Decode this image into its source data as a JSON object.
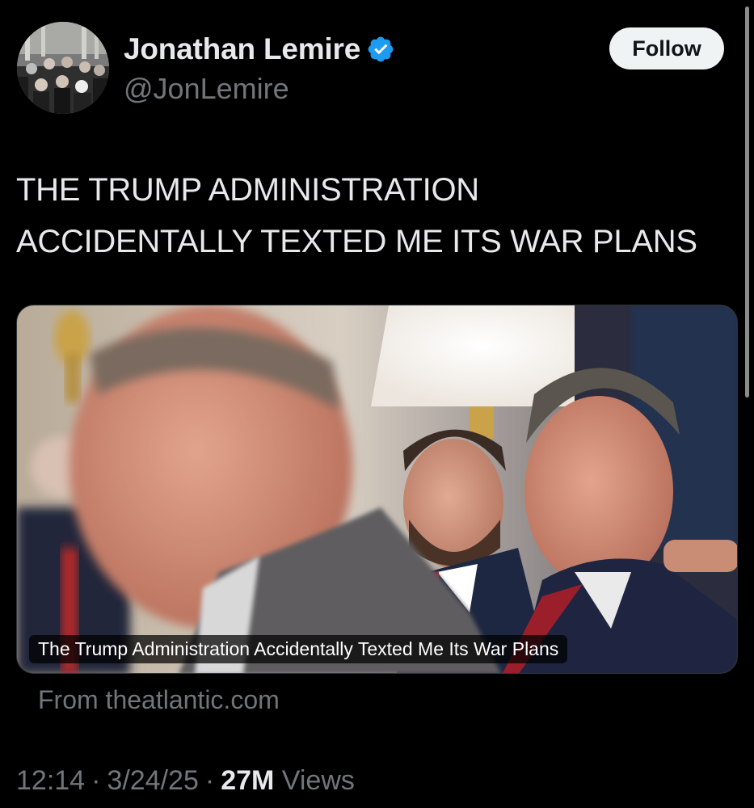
{
  "author": {
    "display_name": "Jonathan Lemire",
    "handle": "@JonLemire",
    "avatar_icon": "avatar-photo",
    "verified_icon": "verified-badge-icon",
    "verified_color": "#1d9bf0"
  },
  "actions": {
    "follow_label": "Follow"
  },
  "tweet": {
    "text_lines": [
      "THE TRUMP ADMINISTRATION",
      "ACCIDENTALLY TEXTED ME ITS WAR PLANS"
    ]
  },
  "link_card": {
    "caption": "The Trump Administration Accidentally Texted Me Its War Plans",
    "source": "From theatlantic.com"
  },
  "meta": {
    "time": "12:14",
    "date": "3/24/25",
    "view_count": "27M",
    "views_label": "Views",
    "separator": "·"
  }
}
